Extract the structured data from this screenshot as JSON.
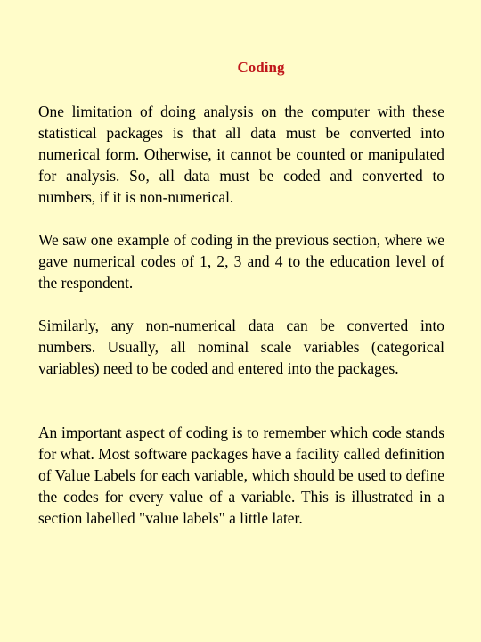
{
  "document": {
    "title": "Coding",
    "paragraphs": [
      "One limitation of doing analysis on the computer with these statistical packages is that all data must be converted into numerical form.  Otherwise, it cannot be counted or manipulated for analysis.  So, all data must be coded and converted to numbers, if it is non-numerical.",
      "We saw one example of coding in the previous section, where we gave numerical codes of 1, 2, 3 and 4 to the education level of the respondent.",
      "Similarly, any non-numerical data can be converted into numbers.    Usually, all nominal scale variables (categorical variables) need to be coded and entered into the packages.",
      "An important aspect of coding is to remember which code stands for what. Most software packages have a facility called definition of Value Labels for each variable, which should be used to define the codes for every value of a variable. This is illustrated in a section labelled \"value labels\" a little later."
    ]
  },
  "colors": {
    "background": "#FFFCC9",
    "title": "#C0171B",
    "text": "#000000"
  }
}
